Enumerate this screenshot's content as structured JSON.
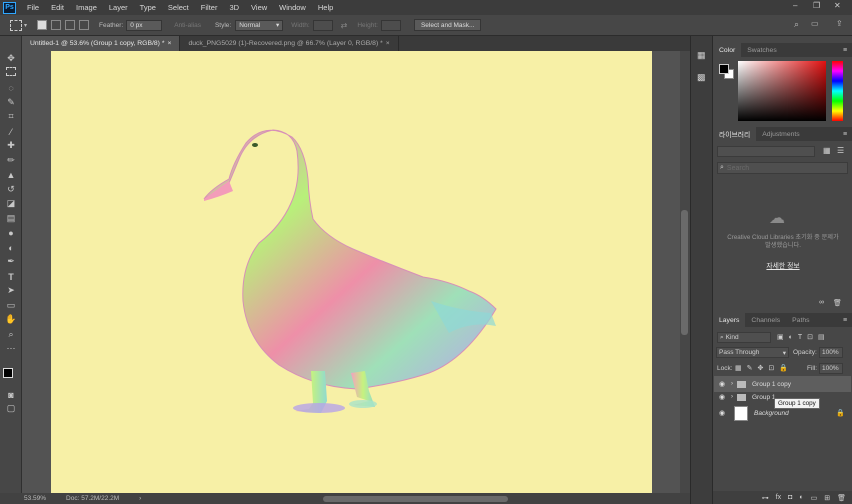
{
  "app": {
    "logo_text": "Ps"
  },
  "menu": [
    "File",
    "Edit",
    "Image",
    "Layer",
    "Type",
    "Select",
    "Filter",
    "3D",
    "View",
    "Window",
    "Help"
  ],
  "window_controls": {
    "minimize": "–",
    "restore": "❐",
    "close": "✕"
  },
  "options": {
    "feather_label": "Feather:",
    "feather_value": "0 px",
    "antialias_label": "Anti-alias",
    "style_label": "Style:",
    "style_value": "Normal",
    "width_label": "Width:",
    "height_label": "Height:",
    "select_mask_label": "Select and Mask..."
  },
  "doc_tabs": [
    {
      "label": "Untitled-1 @ 53.6% (Group 1 copy, RGB/8) *",
      "close": "×"
    },
    {
      "label": "duck_PNG5029 (1)-Recovered.png @ 66.7% (Layer 0, RGB/8) *",
      "close": "×"
    }
  ],
  "status": {
    "zoom": "53.59%",
    "doc": "Doc: 57.2M/22.2M",
    "arrow": "›"
  },
  "color_panel": {
    "tabs": [
      "Color",
      "Swatches"
    ]
  },
  "libraries": {
    "tabs": [
      "라이브러리",
      "Adjustments"
    ],
    "search_placeholder": "Search",
    "message": "Creative Cloud Libraries 초기화 중 문제가 발생했습니다.",
    "link": "자세한 정보"
  },
  "layers": {
    "tabs": [
      "Layers",
      "Channels",
      "Paths"
    ],
    "kind_label": "Kind",
    "blend_mode": "Pass Through",
    "opacity_label": "Opacity:",
    "opacity_value": "100%",
    "lock_label": "Lock:",
    "fill_label": "Fill:",
    "fill_value": "100%",
    "items": [
      {
        "name": "Group 1 copy"
      },
      {
        "name": "Group 1"
      },
      {
        "name": "Background"
      }
    ],
    "tooltip": "Group 1 copy"
  },
  "accent": {
    "canvas_bg": "#f7f0a6",
    "selected_layer": "#5e5e5e"
  }
}
